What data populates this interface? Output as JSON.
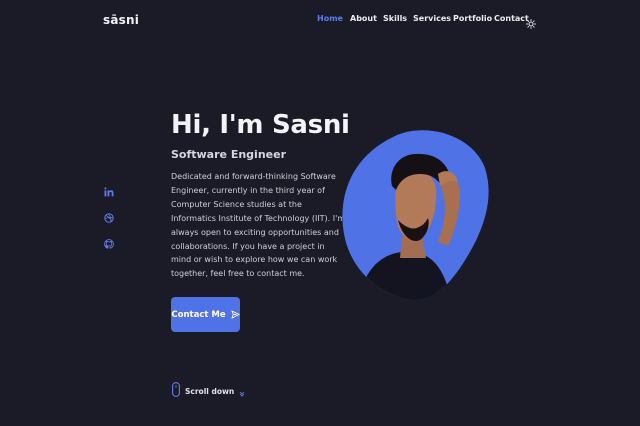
{
  "header": {
    "logo": "sāsni",
    "nav": [
      {
        "label": "Home",
        "active": true
      },
      {
        "label": "About",
        "active": false
      },
      {
        "label": "Skills",
        "active": false
      },
      {
        "label": "Services",
        "active": false
      },
      {
        "label": "Portfolio",
        "active": false
      },
      {
        "label": "Contact",
        "active": false
      }
    ],
    "theme_icon": "sun-icon"
  },
  "social": [
    {
      "icon": "linkedin-icon"
    },
    {
      "icon": "dribbble-icon"
    },
    {
      "icon": "github-icon"
    }
  ],
  "hero": {
    "title": "Hi, I'm Sasni",
    "subtitle": "Software Engineer",
    "description": "Dedicated and forward-thinking Software Engineer, currently in the third year of Computer Science studies at the Informatics Institute of Technology (IIT). I'm always open to exciting opportunities and collaborations. If you have a project in mind or wish to explore how we can work together, feel free to contact me.",
    "cta_label": "Contact Me",
    "cta_icon": "send-icon"
  },
  "profile_image": {
    "icon": "profile-photo"
  },
  "scroll": {
    "label": "Scroll down",
    "icon": "mouse-icon",
    "arrow_icon": "chevron-down-icon"
  },
  "colors": {
    "background": "#1a1b26",
    "accent": "#4f72e6",
    "active_nav": "#5f7cec",
    "text": "#e9e9ee"
  }
}
